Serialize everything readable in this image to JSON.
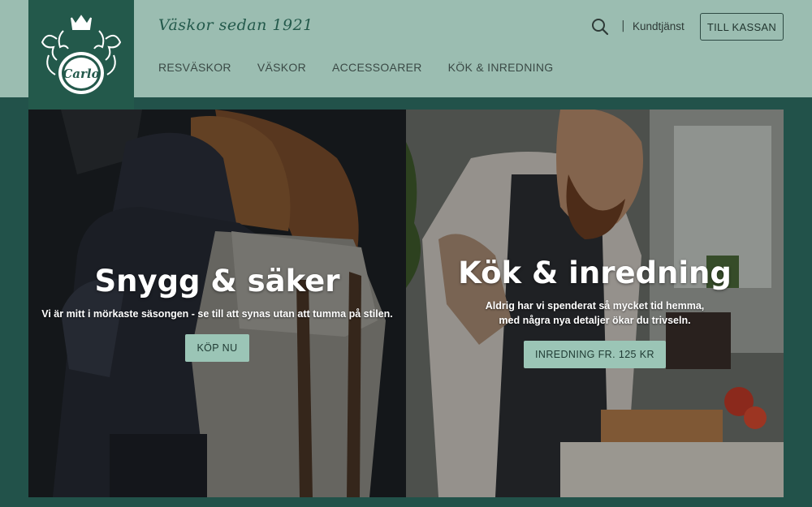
{
  "header": {
    "logo_text": "Carlo",
    "tagline": "Väskor sedan 1921",
    "nav": [
      "RESVÄSKOR",
      "VÄSKOR",
      "ACCESSOARER",
      "KÖK & INREDNING"
    ],
    "separator": "|",
    "support_label": "Kundtjänst",
    "checkout_label": "TILL KASSAN"
  },
  "heroes": [
    {
      "title": "Snygg & säker",
      "text": "Vi är mitt i mörkaste säsongen - se till att synas utan att tumma på stilen.",
      "button": "KÖP NU"
    },
    {
      "title": "Kök & inredning",
      "text_line1": "Aldrig har vi spenderat så mycket tid hemma,",
      "text_line2": "med några nya detaljer ökar du trivseln.",
      "button": "INREDNING FR. 125 KR"
    }
  ],
  "colors": {
    "header_bg": "#9bbdb1",
    "brand_green": "#23594b",
    "page_bg": "#22524a",
    "button_bg": "#9bc5b6"
  }
}
